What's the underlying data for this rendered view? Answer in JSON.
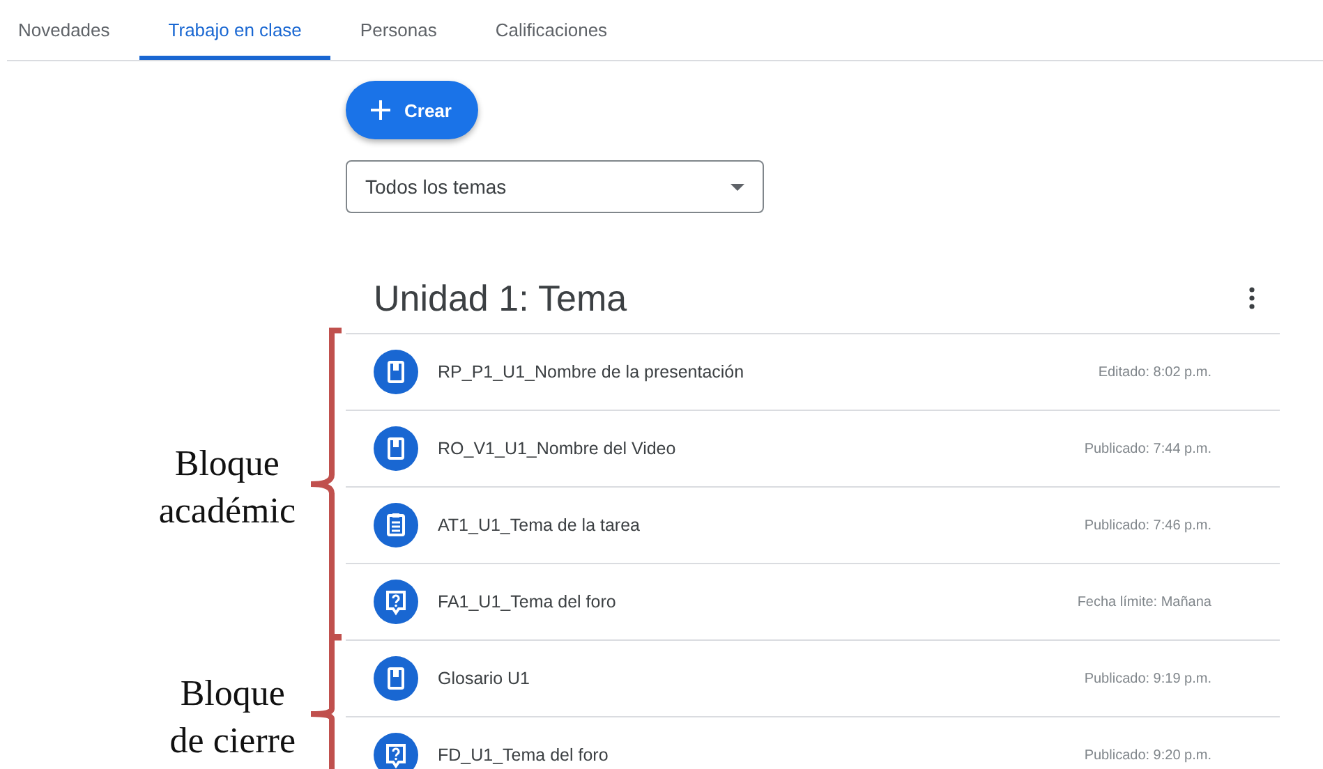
{
  "tabs": [
    {
      "label": "Novedades",
      "selected": false
    },
    {
      "label": "Trabajo en clase",
      "selected": true
    },
    {
      "label": "Personas",
      "selected": false
    },
    {
      "label": "Calificaciones",
      "selected": false
    }
  ],
  "create_button": {
    "label": "Crear"
  },
  "topic_filter": {
    "value": "Todos los temas"
  },
  "section": {
    "title": "Unidad 1: Tema",
    "groups": [
      {
        "annotation": "Bloque\nacadémic",
        "items": [
          {
            "kind": "material",
            "title": "RP_P1_U1_Nombre de la presentación",
            "meta": "Editado: 8:02 p.m."
          },
          {
            "kind": "material",
            "title": "RO_V1_U1_Nombre del Video",
            "meta": "Publicado: 7:44 p.m."
          },
          {
            "kind": "assignment",
            "title": "AT1_U1_Tema de la tarea",
            "meta": "Publicado: 7:46 p.m."
          },
          {
            "kind": "question",
            "title": "FA1_U1_Tema del foro",
            "meta": "Fecha límite: Mañana"
          }
        ]
      },
      {
        "annotation": "Bloque\nde cierre",
        "items": [
          {
            "kind": "material",
            "title": "Glosario U1",
            "meta": "Publicado: 9:19 p.m."
          },
          {
            "kind": "question",
            "title": "FD_U1_Tema del foro",
            "meta": "Publicado: 9:20 p.m."
          }
        ]
      }
    ]
  }
}
